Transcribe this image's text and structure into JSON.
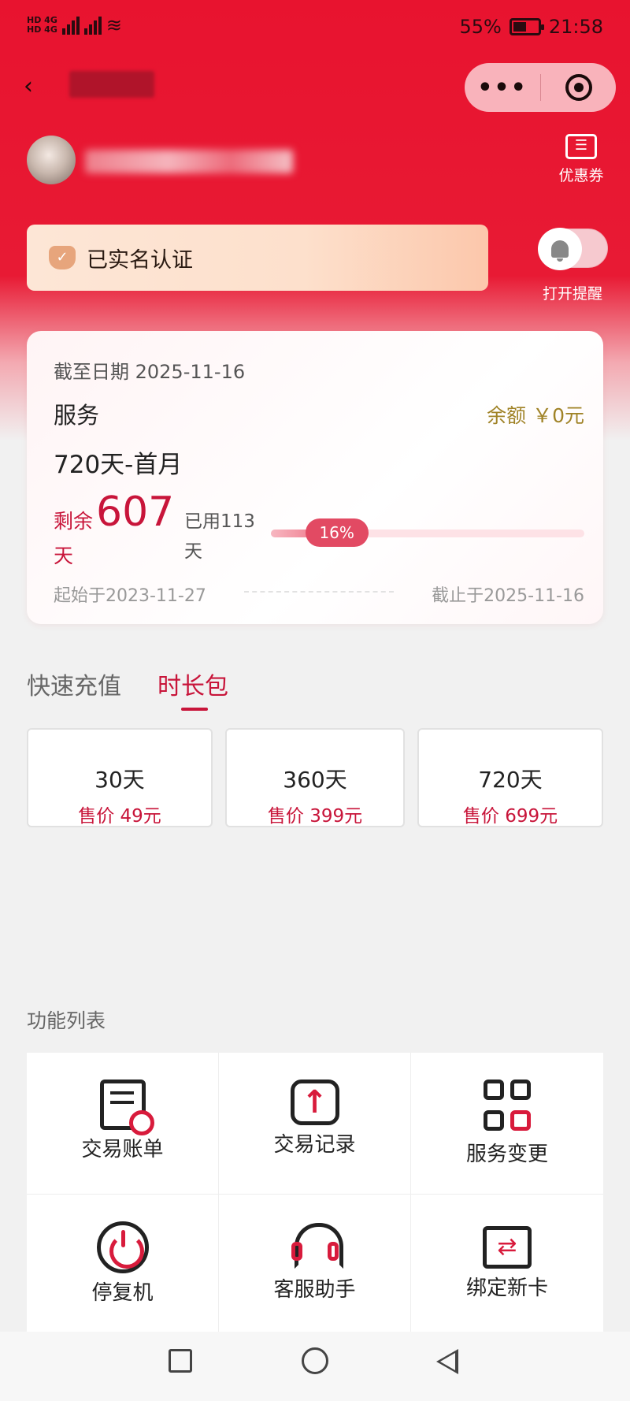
{
  "status_bar": {
    "network_1": "HD 4G",
    "network_2": "HD 4G",
    "battery": "55%",
    "time": "21:58"
  },
  "header": {
    "back_icon": "back-arrow-icon",
    "more_icon": "more-dots-icon",
    "close_icon": "mini-program-close-icon"
  },
  "profile": {
    "coupon_label": "优惠券",
    "verified_label": "已实名认证",
    "reminder_label": "打开提醒"
  },
  "service": {
    "date": "截至日期 2025-11-16",
    "name": "服务",
    "balance": "余额 ￥0元",
    "plan": "720天-首月",
    "remaining_label": "剩余",
    "remaining_days": "607",
    "remaining_unit": "天",
    "used_label": "已用113",
    "used_unit": "天",
    "progress_percent": 16,
    "progress_text": "16%",
    "start": "起始于2023-11-27",
    "end": "截止于2025-11-16"
  },
  "tabs": [
    {
      "label": "快速充值",
      "active": false
    },
    {
      "label": "时长包",
      "active": true
    }
  ],
  "packages": [
    {
      "days": "30天",
      "price": "售价 49元"
    },
    {
      "days": "360天",
      "price": "售价 399元"
    },
    {
      "days": "720天",
      "price": "售价 699元"
    }
  ],
  "functions": {
    "title": "功能列表",
    "items": [
      {
        "label": "交易账单",
        "icon": "bill-search-icon"
      },
      {
        "label": "交易记录",
        "icon": "upload-record-icon"
      },
      {
        "label": "服务变更",
        "icon": "grid-apps-icon"
      },
      {
        "label": "停复机",
        "icon": "power-icon"
      },
      {
        "label": "客服助手",
        "icon": "headset-icon"
      },
      {
        "label": "绑定新卡",
        "icon": "card-swap-icon"
      }
    ]
  },
  "colors": {
    "brand_red": "#e8132f",
    "accent_red": "#c8153a",
    "gold": "#a08327"
  }
}
